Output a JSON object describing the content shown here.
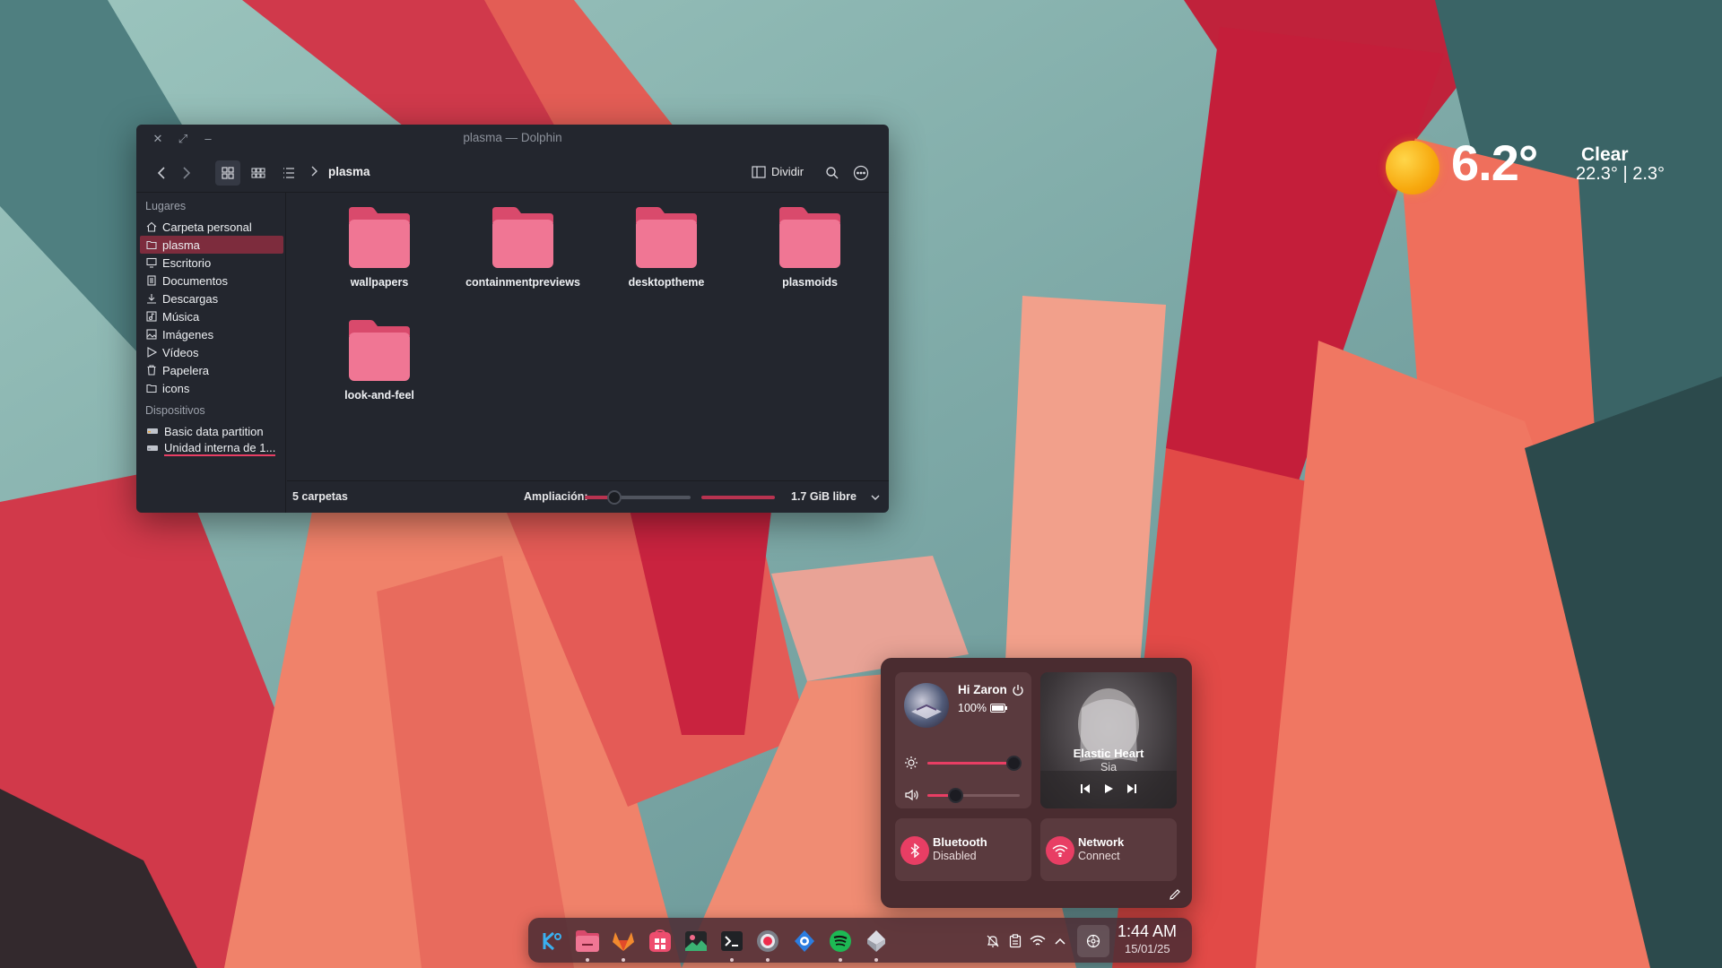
{
  "colors": {
    "accent": "#e83e64",
    "folder": "#f06a8a",
    "window_bg": "#23262e",
    "panel_bg": "#4a2c30"
  },
  "dolphin": {
    "title": "plasma — Dolphin",
    "breadcrumb": "plasma",
    "split_label": "Dividir",
    "sidebar": {
      "places_header": "Lugares",
      "places": [
        {
          "label": "Carpeta personal",
          "icon": "home-icon"
        },
        {
          "label": "plasma",
          "icon": "folder-icon"
        },
        {
          "label": "Escritorio",
          "icon": "desktop-icon"
        },
        {
          "label": "Documentos",
          "icon": "document-icon"
        },
        {
          "label": "Descargas",
          "icon": "download-icon"
        },
        {
          "label": "Música",
          "icon": "music-icon"
        },
        {
          "label": "Imágenes",
          "icon": "image-icon"
        },
        {
          "label": "Vídeos",
          "icon": "video-icon"
        },
        {
          "label": "Papelera",
          "icon": "trash-icon"
        },
        {
          "label": "icons",
          "icon": "folder-icon"
        }
      ],
      "devices_header": "Dispositivos",
      "devices": [
        {
          "label": "Basic data partition",
          "icon": "drive-icon"
        },
        {
          "label": "Unidad interna de 1...",
          "icon": "drive-icon"
        }
      ]
    },
    "folders": [
      "wallpapers",
      "containmentpreviews",
      "desktoptheme",
      "plasmoids",
      "look-and-feel"
    ],
    "status": {
      "count": "5 carpetas",
      "zoom_label": "Ampliación:",
      "zoom_level": 0.28,
      "free_space": "1.7 GiB libre"
    }
  },
  "weather": {
    "temperature": "6.2°",
    "condition": "Clear",
    "range": "22.3° | 2.3°"
  },
  "control_panel": {
    "greeting": "Hi Zaron",
    "battery": "100%",
    "brightness": 0.93,
    "volume": 0.3,
    "media": {
      "song": "Elastic Heart",
      "artist": "Sia"
    },
    "bluetooth": {
      "label": "Bluetooth",
      "status": "Disabled"
    },
    "network": {
      "label": "Network",
      "status": "Connect"
    }
  },
  "dock": {
    "apps": [
      "kde-launcher-icon",
      "files-icon",
      "gitlab-icon",
      "store-icon",
      "photos-icon",
      "terminal-icon",
      "screen-recorder-icon",
      "plasma-connect-icon",
      "spotify-icon",
      "vpn-icon"
    ],
    "time": "1:44 AM",
    "date": "15/01/25"
  }
}
